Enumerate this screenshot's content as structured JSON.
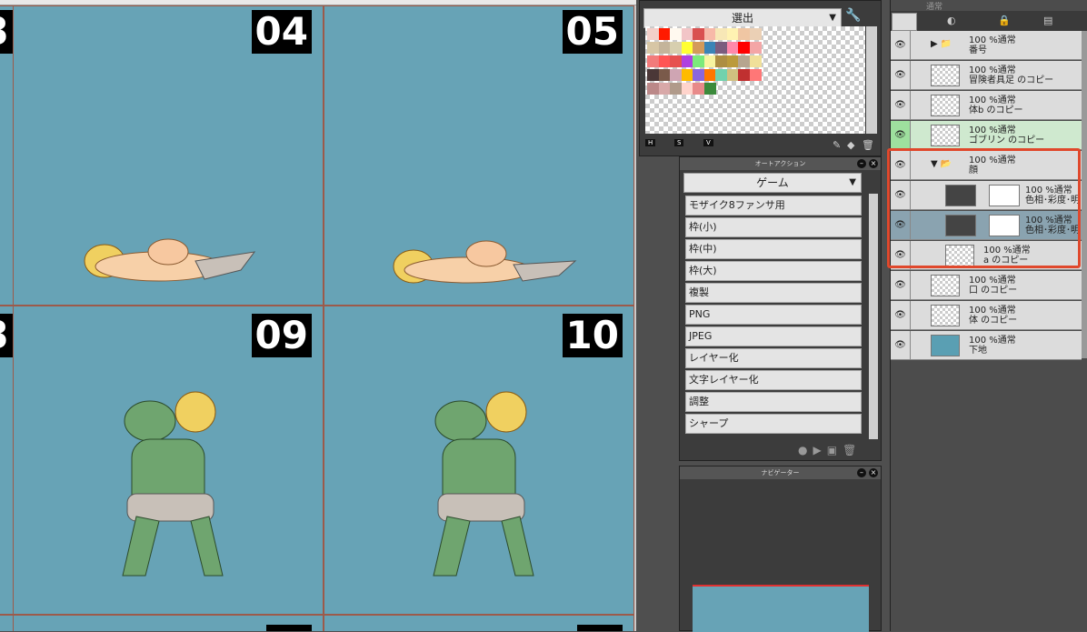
{
  "canvas": {
    "frames": [
      {
        "number": "04"
      },
      {
        "number": "05"
      },
      {
        "number": "09"
      },
      {
        "number": "10"
      },
      {
        "number": "3"
      },
      {
        "number": "3"
      }
    ]
  },
  "color_palette": {
    "set_name": "選出",
    "bottom_labels": [
      "H",
      "S",
      "V"
    ],
    "colors": [
      "#f3cfc9",
      "#ff1a00",
      "#fff9ef",
      "#f2c5c7",
      "#d95050",
      "#f7b9a8",
      "#f7e7b6",
      "#fff2b2",
      "#f0c6a3",
      "#ebd0b5",
      "#d7c6a5",
      "#c4b49a",
      "#d7cfaf",
      "#ffff33",
      "#d49a5a",
      "#3b84b6",
      "#7b5c7e",
      "#ff88aa",
      "#ff0000",
      "#f4a6a6",
      "#f27b7b",
      "#ff5555",
      "#e65050",
      "#b040e0",
      "#7bea7b",
      "#f7f4a0",
      "#ad8e42",
      "#bb9a3c",
      "#b6a58f",
      "#f0e09a",
      "#4a3737",
      "#7a5a4a",
      "#cfa5b3",
      "#ffbb00",
      "#8b66dd",
      "#ff7700",
      "#72d2ad",
      "#d0c080",
      "#c03030",
      "#ff7777",
      "#bb8888",
      "#d8a8a8",
      "#b09a8a",
      "#ffd4cc",
      "#e88a8a",
      "#3b8a3b"
    ]
  },
  "auto_action": {
    "title": "オートアクション",
    "set_name": "ゲーム",
    "items": [
      "モザイク8ファンサ用",
      "枠(小)",
      "枠(中)",
      "枠(大)",
      "複製",
      "PNG",
      "JPEG",
      "レイヤー化",
      "文字レイヤー化",
      "調整",
      "シャープ"
    ]
  },
  "navigator": {
    "title": "ナビゲーター"
  },
  "layers": {
    "blend_mode": "通常",
    "rows": [
      {
        "l1": "100 %通常",
        "l2": "番号",
        "kind": "folder"
      },
      {
        "l1": "100 %通常",
        "l2": "冒険者具足 のコピー",
        "kind": "layer"
      },
      {
        "l1": "100 %通常",
        "l2": "体b のコピー",
        "kind": "layer"
      },
      {
        "l1": "100 %通常",
        "l2": "ゴブリン のコピー",
        "kind": "layer"
      },
      {
        "l1": "100 %通常",
        "l2": "顔",
        "kind": "folder"
      },
      {
        "l1": "100 %通常",
        "l2": "色相･彩度･明",
        "kind": "adjust"
      },
      {
        "l1": "100 %通常",
        "l2": "色相･彩度･明",
        "kind": "adjust"
      },
      {
        "l1": "100 %通常",
        "l2": "a のコピー",
        "kind": "layer"
      },
      {
        "l1": "100 %通常",
        "l2": "口 のコピー",
        "kind": "layer"
      },
      {
        "l1": "100 %通常",
        "l2": "体 のコピー",
        "kind": "layer"
      },
      {
        "l1": "100 %通常",
        "l2": "下地",
        "kind": "base"
      }
    ]
  }
}
